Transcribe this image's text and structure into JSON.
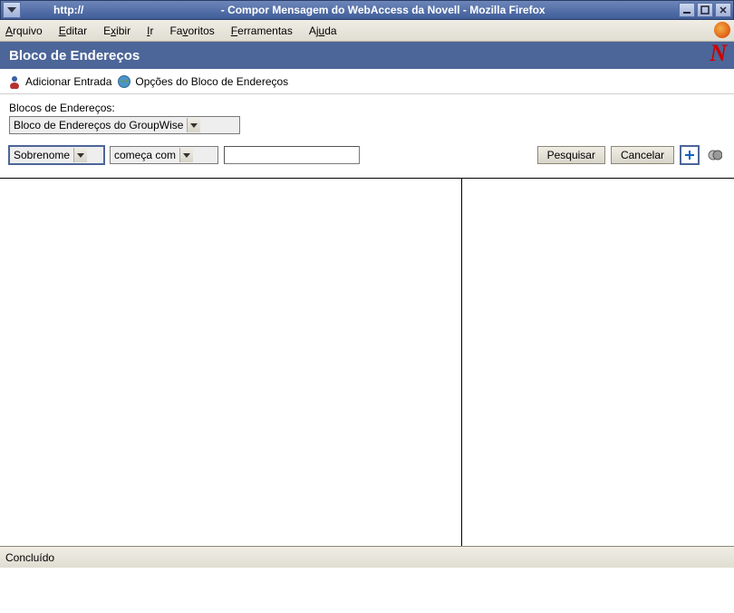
{
  "window": {
    "url_prefix": "http://",
    "title": "- Compor Mensagem do WebAccess da Novell - Mozilla Firefox"
  },
  "menu": {
    "arquivo": "Arquivo",
    "editar": "Editar",
    "exibir": "Exibir",
    "ir": "Ir",
    "favoritos": "Favoritos",
    "ferramentas": "Ferramentas",
    "ajuda": "Ajuda"
  },
  "header": {
    "title": "Bloco de Endereços"
  },
  "toolbar": {
    "add_entry": "Adicionar Entrada",
    "options": "Opções do Bloco de Endereços"
  },
  "addressbook": {
    "label": "Blocos de Endereços:",
    "selected": "Bloco de Endereços do GroupWise"
  },
  "search": {
    "field_selected": "Sobrenome",
    "mode_selected": "começa com",
    "value": "",
    "placeholder": "",
    "search_btn": "Pesquisar",
    "cancel_btn": "Cancelar"
  },
  "status": {
    "text": "Concluído"
  }
}
